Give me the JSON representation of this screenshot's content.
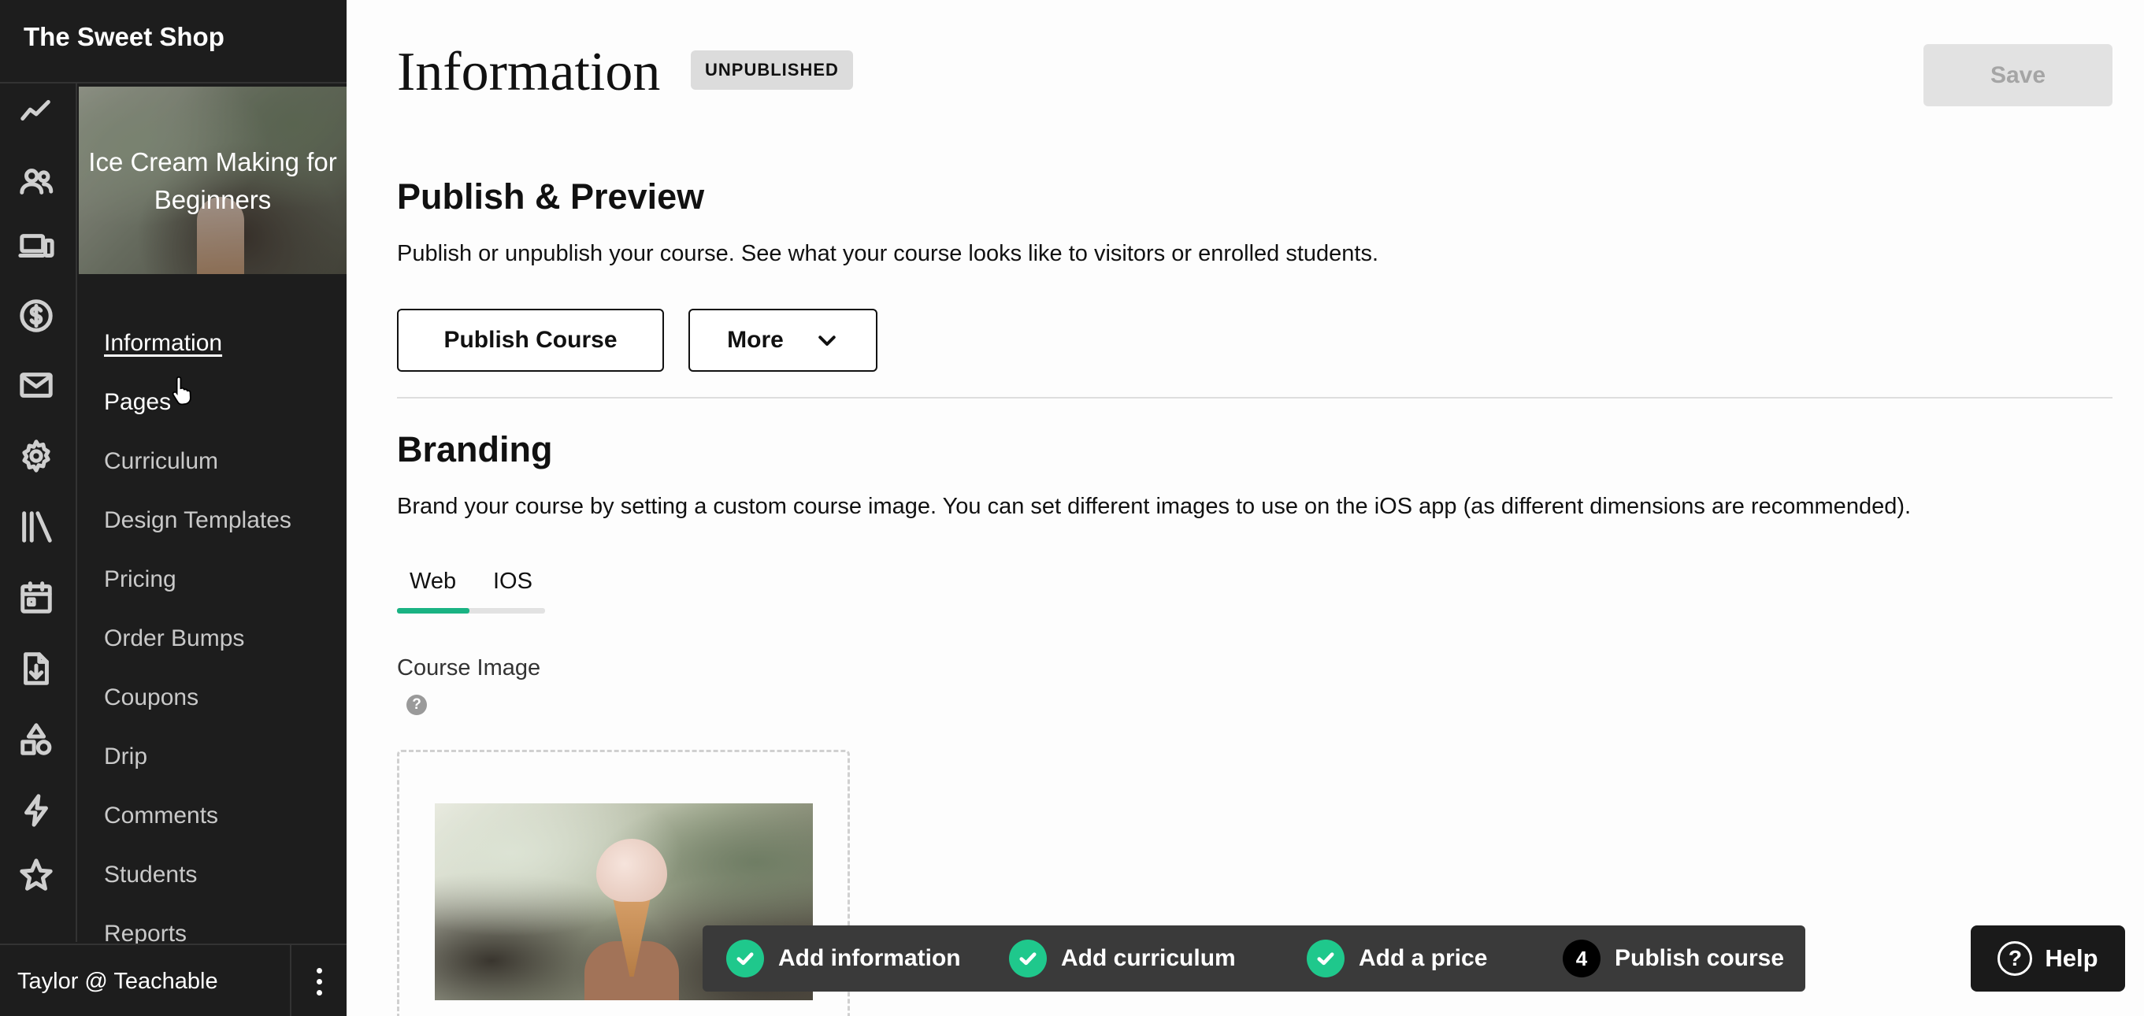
{
  "school": {
    "name": "The Sweet Shop"
  },
  "sidebar": {
    "rail_icons": [
      "analytics-icon",
      "users-icon",
      "devices-icon",
      "dollar-icon",
      "mail-icon",
      "gear-icon",
      "library-icon",
      "calendar-icon",
      "download-icon",
      "shapes-icon",
      "lightning-icon",
      "star-icon"
    ],
    "course_title": "Ice Cream Making for Beginners",
    "nav": [
      {
        "label": "Information",
        "state": "active"
      },
      {
        "label": "Pages",
        "state": "hover"
      },
      {
        "label": "Curriculum"
      },
      {
        "label": "Design Templates"
      },
      {
        "label": "Pricing"
      },
      {
        "label": "Order Bumps"
      },
      {
        "label": "Coupons"
      },
      {
        "label": "Drip"
      },
      {
        "label": "Comments"
      },
      {
        "label": "Students"
      },
      {
        "label": "Reports"
      }
    ],
    "user_label": "Taylor @ Teachable"
  },
  "header": {
    "title": "Information",
    "status_badge": "UNPUBLISHED",
    "save_label": "Save"
  },
  "publish": {
    "heading": "Publish & Preview",
    "description": "Publish or unpublish your course. See what your course looks like to visitors or enrolled students.",
    "publish_button": "Publish Course",
    "more_button": "More"
  },
  "branding": {
    "heading": "Branding",
    "description": "Brand your course by setting a custom course image. You can set different images to use on the iOS app (as different dimensions are recommended).",
    "tabs": [
      "Web",
      "IOS"
    ],
    "active_tab": "Web",
    "course_image_label": "Course Image"
  },
  "checklist": {
    "steps": [
      {
        "label": "Add information",
        "done": true
      },
      {
        "label": "Add curriculum",
        "done": true
      },
      {
        "label": "Add a price",
        "done": true
      },
      {
        "label": "Publish course",
        "done": false,
        "number": "4"
      }
    ]
  },
  "help": {
    "label": "Help"
  },
  "colors": {
    "sidebar_bg": "#1d1d1d",
    "accent_green": "#1fc88c",
    "tab_indicator": "#1ab383",
    "badge_bg": "#dcdcdc",
    "save_disabled_bg": "#e2e2e2",
    "checklist_bg": "#3a3a3a"
  }
}
